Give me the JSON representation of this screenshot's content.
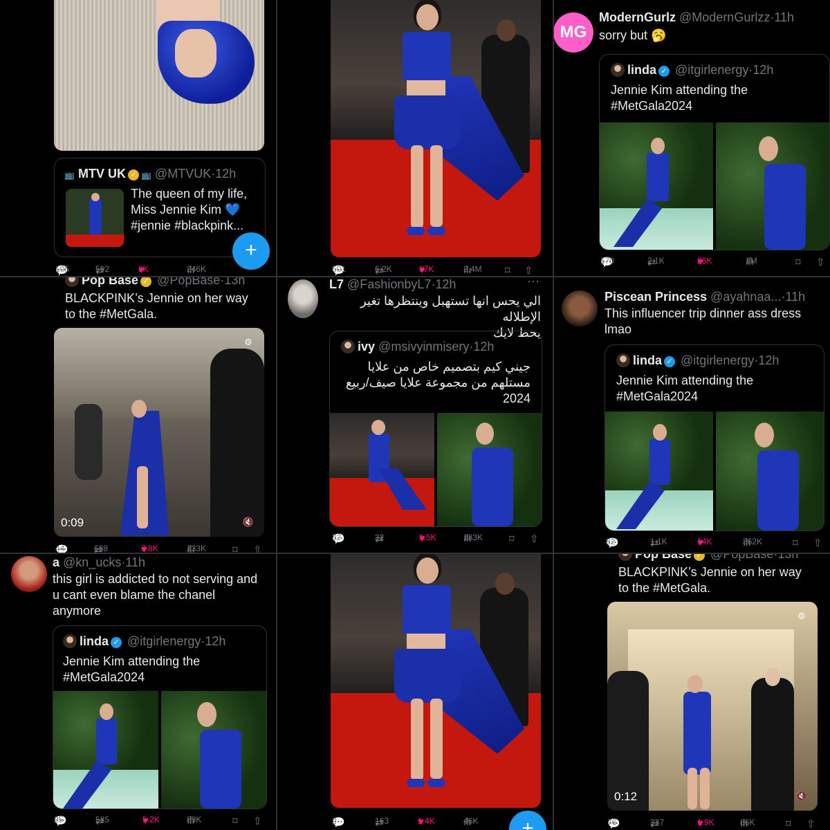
{
  "c1": {
    "quote": {
      "name": "MTV UK",
      "handle": "@MTVUK",
      "time": "12h",
      "text1": "The queen of my life,",
      "text2": "Miss Jennie Kim 💙",
      "text3": "#jennie #blackpink..."
    },
    "stats": {
      "replies": "105",
      "reposts": "592",
      "likes": "3K",
      "views": "246K"
    },
    "fab_icon": "+"
  },
  "c2": {
    "stats": {
      "replies": "501",
      "reposts": "6.2K",
      "likes": "37K",
      "views": "2.4M"
    }
  },
  "c3": {
    "name": "ModernGurlz",
    "handle": "@ModernGurlzz",
    "time": "11h",
    "avatar_text": "MG",
    "text": "sorry but 🥱",
    "quote": {
      "name": "linda",
      "handle": "@itgirlenergy",
      "time": "12h",
      "text1": "Jennie Kim attending the",
      "text2": "#MetGala2024"
    },
    "stats": {
      "replies": "170",
      "reposts": "2.1K",
      "likes": "26K",
      "views": "1M"
    }
  },
  "c4": {
    "name": "Pop Base",
    "handle": "@PopBase",
    "time": "13h",
    "text1": "BLACKPINK’s Jennie on her way",
    "text2": "to the #MetGala.",
    "video_time": "0:09",
    "stats": {
      "replies": "44",
      "reposts": "688",
      "likes": "7.8K",
      "views": "133K"
    }
  },
  "c5": {
    "name": "L7",
    "handle": "@FashionbyL7",
    "time": "12h",
    "text1": "الي يحس انها تستهبل وينتظرها تغير الإطلاله",
    "text2": "يحط لايك",
    "quote": {
      "name": "ivy",
      "handle": "@msivyinmisery",
      "time": "12h",
      "text1": "جيني كيم بتصميم خاص من علايا",
      "text2": "مستلهم من مجموعة علايا صيف/ربيع",
      "text3": "2024"
    },
    "stats": {
      "replies": "32",
      "reposts": "32",
      "likes": "1.5K",
      "views": "183K"
    }
  },
  "c6": {
    "name": "Piscean Princess",
    "handle": "@ayahnaa...",
    "time": "11h",
    "text1": "This influencer trip dinner ass dress",
    "text2": "lmao",
    "quote": {
      "name": "linda",
      "handle": "@itgirlenergy",
      "time": "12h",
      "text1": "Jennie Kim attending the",
      "text2": "#MetGala2024"
    },
    "stats": {
      "replies": "82",
      "reposts": "1.1K",
      "likes": "14K",
      "views": "362K"
    }
  },
  "c7": {
    "name": "a",
    "handle": "@kn_ucks",
    "time": "11h",
    "text1": "this girl is addicted to not serving and",
    "text2": "u cant even blame the chanel",
    "text3": "anymore",
    "quote": {
      "name": "linda",
      "handle": "@itgirlenergy",
      "time": "12h",
      "text1": "Jennie Kim attending the",
      "text2": "#MetGala2024"
    },
    "stats": {
      "replies": "25",
      "reposts": "585",
      "likes": "5.2K",
      "views": "89K"
    }
  },
  "c8": {
    "stats": {
      "replies": "2",
      "reposts": "163",
      "likes": "1.4K",
      "views": "46K"
    },
    "fab_icon": "+"
  },
  "c9": {
    "name": "Pop Base",
    "handle": "@PopBase",
    "time": "13h",
    "text1": "BLACKPINK’s Jennie on her way",
    "text2": "to the #MetGala.",
    "video_time": "0:12",
    "stats": {
      "replies": "76",
      "reposts": "337",
      "likes": "1.9K",
      "views": "86K"
    }
  },
  "colors": {
    "accent": "#1d9bf0",
    "like": "#f91880",
    "carpet": "#c4180f",
    "gown": "#1f36b8"
  }
}
